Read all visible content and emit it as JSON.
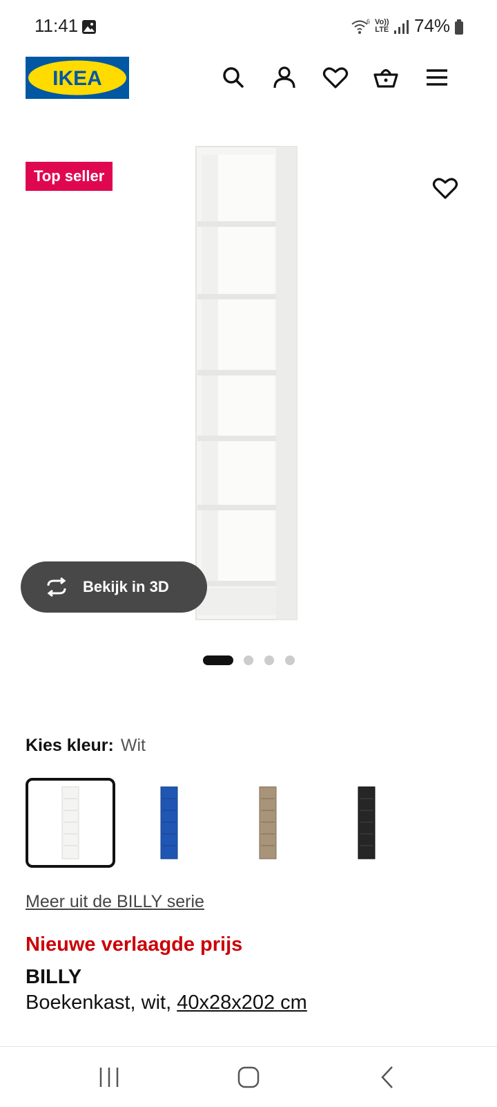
{
  "status_bar": {
    "time": "11:41",
    "volte_line1": "Vo))",
    "volte_line2": "LTE",
    "battery": "74%"
  },
  "header": {
    "logo_text": "IKEA",
    "icons": [
      "search-icon",
      "account-icon",
      "wishlist-icon",
      "cart-icon",
      "menu-icon"
    ]
  },
  "product_image": {
    "badge": "Top seller",
    "view_3d_label": "Bekijk in 3D",
    "carousel_count": 4,
    "carousel_active": 1
  },
  "color_picker": {
    "label": "Kies kleur:",
    "selected": "Wit",
    "options": [
      {
        "color": "#f4f4f2",
        "selected": true
      },
      {
        "color": "#1f56b4",
        "selected": false
      },
      {
        "color": "#a89478",
        "selected": false
      },
      {
        "color": "#262626",
        "selected": false
      }
    ]
  },
  "product": {
    "series_link": "Meer uit de BILLY serie",
    "price_note": "Nieuwe verlaagde prijs",
    "name": "BILLY",
    "description": "Boekenkast, wit,",
    "size": "40x28x202 cm"
  },
  "nav_bar": {
    "buttons": [
      "recent-apps-icon",
      "home-icon",
      "back-icon"
    ]
  },
  "colors": {
    "ikea_blue": "#0058a3",
    "ikea_yellow": "#ffdb00",
    "badge_red": "#e00751",
    "price_red": "#cc0008"
  }
}
